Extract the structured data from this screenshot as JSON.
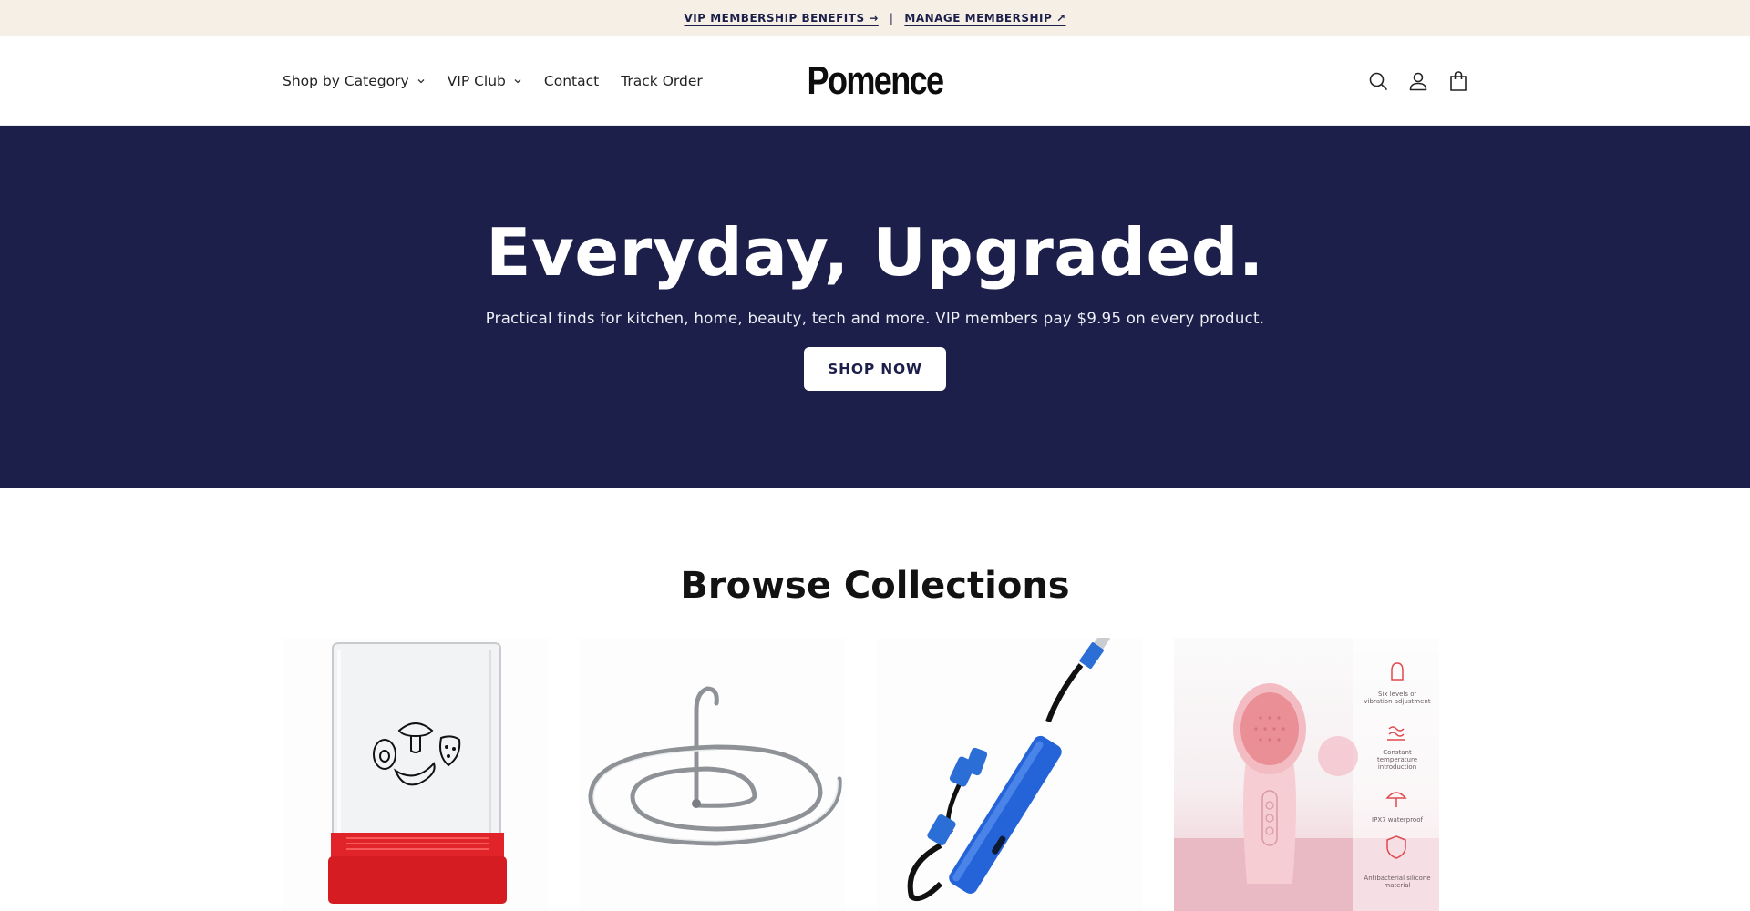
{
  "announcement": {
    "vip_benefits": "VIP MEMBERSHIP BENEFITS →",
    "separator": "|",
    "manage_membership": "MANAGE MEMBERSHIP ↗"
  },
  "header": {
    "nav": [
      {
        "label": "Shop by Category",
        "has_dropdown": true
      },
      {
        "label": "VIP Club",
        "has_dropdown": true
      },
      {
        "label": "Contact",
        "has_dropdown": false
      },
      {
        "label": "Track Order",
        "has_dropdown": false
      }
    ],
    "logo": "Pomence",
    "icons": [
      "search-icon",
      "account-icon",
      "cart-icon"
    ]
  },
  "hero": {
    "title": "Everyday, Upgraded.",
    "subtitle": "Practical finds for kitchen, home, beauty, tech and more. VIP members pay $9.95 on every product.",
    "cta": "SHOP NOW",
    "background": "#1c1f4a"
  },
  "collections": {
    "title": "Browse Collections",
    "cards": [
      {
        "image": "food-storage-container"
      },
      {
        "image": "spiral-hanger"
      },
      {
        "image": "usb-multi-cable"
      },
      {
        "image": "facial-cleansing-brush",
        "features": [
          {
            "line1": "Six levels of",
            "line2": "vibration adjustment"
          },
          {
            "line1": "Constant",
            "line2": "temperature",
            "line3": "introduction"
          },
          {
            "line1": "IPX7 waterproof"
          },
          {
            "line1": "Antibacterial silicone",
            "line2": "material"
          }
        ]
      }
    ]
  },
  "colors": {
    "accent": "#1c1f4a",
    "announcement_bg": "#f5efe6"
  }
}
